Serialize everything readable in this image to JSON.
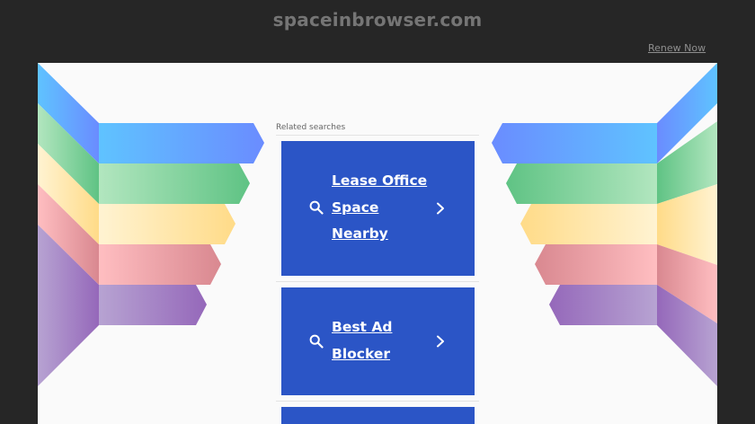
{
  "header": {
    "domain": "spaceinbrowser.com",
    "renew_label": "Renew Now"
  },
  "main": {
    "related_label": "Related searches",
    "cards": [
      {
        "label": "Lease Office Space Nearby",
        "icon_left": "search-icon",
        "icon_right": "chevron-right-icon"
      },
      {
        "label": "Best Ad Blocker",
        "icon_left": "search-icon",
        "icon_right": "chevron-right-icon"
      },
      {
        "label": "",
        "icon_left": "search-icon",
        "icon_right": "chevron-right-icon"
      }
    ]
  },
  "colors": {
    "page_background": "#262626",
    "panel_background": "#fafafa",
    "card_background": "#2b55c6",
    "card_text": "#ffffff",
    "ribbon_colors": [
      "#5fb8ff",
      "#6cc98a",
      "#ffe6a3",
      "#e49a9e",
      "#9e7bc0"
    ]
  }
}
